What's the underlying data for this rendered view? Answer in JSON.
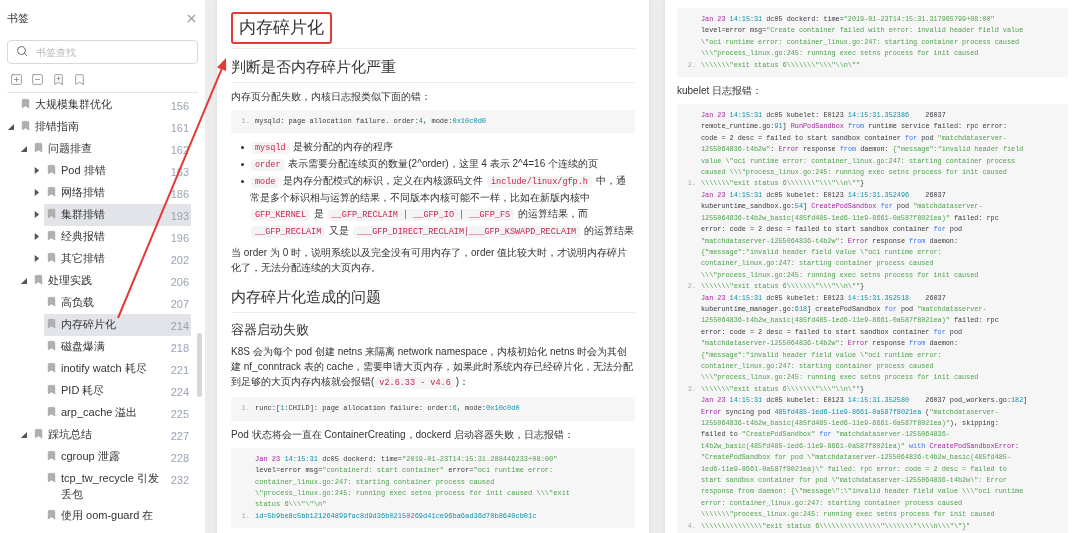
{
  "sidebar": {
    "title": "书签",
    "search": {
      "placeholder": "书签查找"
    },
    "tree": [
      {
        "label": "大规模集群优化",
        "page": "156",
        "selected": false
      },
      {
        "label": "排错指南",
        "page": "161",
        "selected": false,
        "expanded": true,
        "children": [
          {
            "label": "问题排查",
            "page": "162",
            "selected": false,
            "expanded": true,
            "children": [
              {
                "label": "Pod 排错",
                "page": "163",
                "selected": false,
                "expanded": false
              },
              {
                "label": "网络排错",
                "page": "186",
                "selected": false,
                "expanded": false
              },
              {
                "label": "集群排错",
                "page": "193",
                "selected": true,
                "expanded": false
              },
              {
                "label": "经典报错",
                "page": "196",
                "selected": false,
                "expanded": false
              },
              {
                "label": "其它排错",
                "page": "202",
                "selected": false,
                "expanded": false
              }
            ]
          },
          {
            "label": "处理实践",
            "page": "206",
            "selected": false,
            "expanded": true,
            "children": [
              {
                "label": "高负载",
                "page": "207",
                "selected": false
              },
              {
                "label": "内存碎片化",
                "page": "214",
                "selected": true
              },
              {
                "label": "磁盘爆满",
                "page": "218",
                "selected": false
              },
              {
                "label": "inotify watch 耗尽",
                "page": "221",
                "selected": false
              },
              {
                "label": "PID 耗尽",
                "page": "224",
                "selected": false
              },
              {
                "label": "arp_cache 溢出",
                "page": "225",
                "selected": false
              }
            ]
          },
          {
            "label": "踩坑总结",
            "page": "227",
            "selected": false,
            "expanded": true,
            "children": [
              {
                "label": "cgroup 泄露",
                "page": "228",
                "selected": false
              },
              {
                "label": "tcp_tw_recycle 引发丢包",
                "page": "232",
                "selected": false
              },
              {
                "label": "使用 oom-guard 在",
                "selected": false
              }
            ]
          }
        ]
      }
    ]
  },
  "left_page": {
    "title": "内存碎片化",
    "blocks": [
      {
        "kind": "h2",
        "text": "判断是否内存碎片化严重"
      },
      {
        "kind": "para",
        "segments": [
          {
            "kind": "text",
            "text": "内存页分配失败，内核日志报类似下面的错："
          }
        ]
      },
      {
        "kind": "code",
        "lines": [
          {
            "number": "1.",
            "segments": [
              {
                "kind": "plain",
                "text": "mysqld: page allocation failure. order:"
              },
              {
                "kind": "num",
                "text": "4"
              },
              {
                "kind": "plain",
                "text": ", mode:"
              },
              {
                "kind": "num",
                "text": "0x10c0d0"
              }
            ]
          }
        ]
      },
      {
        "kind": "bullets",
        "items": [
          {
            "segments": [
              {
                "kind": "code",
                "text": "mysqld"
              },
              {
                "kind": "text",
                "text": " 是被分配的内存的程序"
              }
            ]
          },
          {
            "segments": [
              {
                "kind": "code",
                "text": "order"
              },
              {
                "kind": "text",
                "text": " 表示需要分配连续页的数量(2^order)，这里 4 表示 2^4=16 个连续的页"
              }
            ]
          },
          {
            "segments": [
              {
                "kind": "code",
                "text": "mode"
              },
              {
                "kind": "text",
                "text": " 是内存分配模式的标识，定义在内核源码文件 "
              },
              {
                "kind": "code",
                "text": "include/linux/gfp.h"
              },
              {
                "kind": "text",
                "text": " 中，通常是多个标识相与运算的结果，不同版本内核可能不一样，比如在新版内核中 "
              },
              {
                "kind": "code",
                "text": "GFP_KERNEL"
              },
              {
                "kind": "text",
                "text": " 是 "
              },
              {
                "kind": "code",
                "text": "__GFP_RECLAIM | __GFP_IO | __GFP_FS"
              },
              {
                "kind": "text",
                "text": " 的运算结果，而 "
              },
              {
                "kind": "code",
                "text": "__GFP_RECLAIM"
              },
              {
                "kind": "text",
                "text": " 又是 "
              },
              {
                "kind": "code",
                "text": "___GFP_DIRECT_RECLAIM|___GFP_KSWAPD_RECLAIM"
              },
              {
                "kind": "text",
                "text": " 的运算结果"
              }
            ]
          }
        ]
      },
      {
        "kind": "para",
        "segments": [
          {
            "kind": "text",
            "text": "当 order 为 0 时，说明系统以及完全没有可用内存了，order 值比较大时，才说明内存碎片化了，无法分配连续的大页内存。"
          }
        ]
      },
      {
        "kind": "h2",
        "text": "内存碎片化造成的问题"
      },
      {
        "kind": "h3",
        "text": "容器启动失败"
      },
      {
        "kind": "para",
        "segments": [
          {
            "kind": "text",
            "text": "K8S 会为每个 pod 创建 netns 来隔离 network namespace，内核初始化 netns 时会为其创建 nf_conntrack 表的 cache，需要申请大页内存，如果此时系统内存已经碎片化，无法分配到足够的大页内存内核就会报错("
          },
          {
            "kind": "code",
            "text": "v2.6.33 - v4.6"
          },
          {
            "kind": "text",
            "text": ")："
          }
        ]
      },
      {
        "kind": "code",
        "lines": [
          {
            "number": "1.",
            "segments": [
              {
                "kind": "plain",
                "text": "runc:["
              },
              {
                "kind": "num",
                "text": "1"
              },
              {
                "kind": "plain",
                "text": ":CHILD]: page allocation failure: order:"
              },
              {
                "kind": "num",
                "text": "6"
              },
              {
                "kind": "plain",
                "text": ", mode:"
              },
              {
                "kind": "num",
                "text": "0x10c0d0"
              }
            ]
          }
        ]
      },
      {
        "kind": "para",
        "segments": [
          {
            "kind": "text",
            "text": "Pod 状态将会一直在 ContainerCreating，dockerd 启动容器失败，日志报错："
          }
        ]
      },
      {
        "kind": "code",
        "lines": [
          {
            "segments": [
              {
                "kind": "kw",
                "text": "Jan 23 "
              },
              {
                "kind": "num",
                "text": "14:15:31"
              },
              {
                "kind": "plain",
                "text": " dc05 dockerd: time="
              },
              {
                "kind": "str",
                "text": "\"2019-01-23T14:15:31.288446233+08:00\""
              }
            ]
          },
          {
            "segments": [
              {
                "kind": "plain",
                "text": "level=error msg="
              },
              {
                "kind": "str",
                "text": "\"containerd: start container\""
              },
              {
                "kind": "plain",
                "text": " error="
              },
              {
                "kind": "str",
                "text": "\"oci runtime error:"
              }
            ]
          },
          {
            "segments": [
              {
                "kind": "str",
                "text": "container_linux.go:247: starting container process caused"
              }
            ]
          },
          {
            "segments": [
              {
                "kind": "str",
                "text": "\\\"process_linux.go:245: running exec setns process for init caused \\\\\\\"exit"
              }
            ]
          },
          {
            "segments": [
              {
                "kind": "str",
                "text": "status 6\\\\\\\"\\\"\\n\""
              }
            ]
          },
          {
            "number": "1.",
            "segments": [
              {
                "kind": "num",
                "text": "id=5b9be8c5bb121264899fac8d9d36b02150269d41ce96ba6ad36d70b8640cb01c"
              }
            ]
          }
        ]
      }
    ]
  },
  "right_page": {
    "blocks": [
      {
        "kind": "code",
        "lines": [
          {
            "segments": [
              {
                "kind": "kw",
                "text": "Jan 23 "
              },
              {
                "kind": "num",
                "text": "14:15:31"
              },
              {
                "kind": "plain",
                "text": " dc05 dockerd: time="
              },
              {
                "kind": "str",
                "text": "\"2019-01-23T14:15:31.317965799+08:00\""
              }
            ]
          },
          {
            "segments": [
              {
                "kind": "plain",
                "text": "level=error msg="
              },
              {
                "kind": "str",
                "text": "\"Create container failed with error: invalid header field value"
              }
            ]
          },
          {
            "segments": [
              {
                "kind": "str",
                "text": "\\\"oci runtime error: container_linux.go:247: starting container process caused"
              }
            ]
          },
          {
            "segments": [
              {
                "kind": "str",
                "text": "\\\\\\\"process_linux.go:245: running exec setns process for init caused"
              }
            ]
          },
          {
            "number": "2.",
            "segments": [
              {
                "kind": "str",
                "text": "\\\\\\\\\\\\\\\"exit status 6\\\\\\\\\\\\\\\"\\\\\\\"\\\\n\\\"\""
              }
            ]
          }
        ]
      },
      {
        "kind": "para",
        "segments": [
          {
            "kind": "text",
            "text": "kubelet 日志报错："
          }
        ]
      },
      {
        "kind": "code",
        "lines": [
          {
            "segments": [
              {
                "kind": "kw",
                "text": "Jan 23 "
              },
              {
                "kind": "num",
                "text": "14:15:31"
              },
              {
                "kind": "plain",
                "text": " dc05 kubelet: E0123 "
              },
              {
                "kind": "num",
                "text": "14:15:31.352386"
              },
              {
                "kind": "plain",
                "text": "    26037"
              }
            ]
          },
          {
            "segments": [
              {
                "kind": "plain",
                "text": "remote_runtime.go:"
              },
              {
                "kind": "num",
                "text": "91"
              },
              {
                "kind": "plain",
                "text": "] "
              },
              {
                "kind": "kw",
                "text": "RunPodSandbox"
              },
              {
                "kind": "key",
                "text": " from"
              },
              {
                "kind": "plain",
                "text": " runtime service failed: rpc error:"
              }
            ]
          },
          {
            "segments": [
              {
                "kind": "plain",
                "text": "code = 2 desc = failed to start sandbox container "
              },
              {
                "kind": "key",
                "text": "for"
              },
              {
                "kind": "plain",
                "text": " pod "
              },
              {
                "kind": "str",
                "text": "\"matchdataserver-"
              }
            ]
          },
          {
            "segments": [
              {
                "kind": "str",
                "text": "1255064836-t4b2w\""
              },
              {
                "kind": "plain",
                "text": ": "
              },
              {
                "kind": "kw",
                "text": "Error"
              },
              {
                "kind": "plain",
                "text": " response "
              },
              {
                "kind": "key",
                "text": "from"
              },
              {
                "kind": "plain",
                "text": " daemon: "
              },
              {
                "kind": "str",
                "text": "{\"message\":\"invalid header field"
              }
            ]
          },
          {
            "segments": [
              {
                "kind": "str",
                "text": "value \\\"oci runtime error: container_linux.go:247: starting container process"
              }
            ]
          },
          {
            "segments": [
              {
                "kind": "str",
                "text": "caused \\\\\\\"process_linux.go:245: running exec setns process for init caused"
              }
            ]
          },
          {
            "number": "1.",
            "segments": [
              {
                "kind": "str",
                "text": "\\\\\\\\\\\\\\\"exit status 6\\\\\\\\\\\\\\\"\\\\\\\"\\\\n\\\"\""
              },
              {
                "kind": "plain",
                "text": "}"
              }
            ]
          },
          {
            "segments": [
              {
                "kind": "kw",
                "text": "Jan 23 "
              },
              {
                "kind": "num",
                "text": "14:15:31"
              },
              {
                "kind": "plain",
                "text": " dc05 kubelet: E0123 "
              },
              {
                "kind": "num",
                "text": "14:15:31.352496"
              },
              {
                "kind": "plain",
                "text": "    26037"
              }
            ]
          },
          {
            "segments": [
              {
                "kind": "plain",
                "text": "kuberuntime_sandbox.go:"
              },
              {
                "kind": "num",
                "text": "54"
              },
              {
                "kind": "plain",
                "text": "] "
              },
              {
                "kind": "kw",
                "text": "CreatePodSandbox"
              },
              {
                "kind": "key",
                "text": " for"
              },
              {
                "kind": "plain",
                "text": " pod "
              },
              {
                "kind": "str",
                "text": "\"matchdataserver-"
              }
            ]
          },
          {
            "segments": [
              {
                "kind": "str",
                "text": "1255064836-t4b2w_basic(485fd485-1ed6-11e9-8661-0a587f8021ea)\""
              },
              {
                "kind": "plain",
                "text": " failed: rpc"
              }
            ]
          },
          {
            "segments": [
              {
                "kind": "plain",
                "text": "error: code = 2 desc = failed to start sandbox container "
              },
              {
                "kind": "key",
                "text": "for"
              },
              {
                "kind": "plain",
                "text": " pod"
              }
            ]
          },
          {
            "segments": [
              {
                "kind": "str",
                "text": "\"matchdataserver-1255064836-t4b2w\""
              },
              {
                "kind": "plain",
                "text": ": "
              },
              {
                "kind": "kw",
                "text": "Error"
              },
              {
                "kind": "plain",
                "text": " response "
              },
              {
                "kind": "key",
                "text": "from"
              },
              {
                "kind": "plain",
                "text": " daemon:"
              }
            ]
          },
          {
            "segments": [
              {
                "kind": "str",
                "text": "{\"message\":\"invalid header field value \\\"oci runtime error:"
              }
            ]
          },
          {
            "segments": [
              {
                "kind": "str",
                "text": "container_linux.go:247: starting container process caused"
              }
            ]
          },
          {
            "segments": [
              {
                "kind": "str",
                "text": "\\\\\\\"process_linux.go:245: running exec setns process for init caused"
              }
            ]
          },
          {
            "number": "2.",
            "segments": [
              {
                "kind": "str",
                "text": "\\\\\\\\\\\\\\\"exit status 6\\\\\\\\\\\\\\\"\\\\\\\"\\\\n\\\"\""
              },
              {
                "kind": "plain",
                "text": "}"
              }
            ]
          },
          {
            "segments": [
              {
                "kind": "kw",
                "text": "Jan 23 "
              },
              {
                "kind": "num",
                "text": "14:15:31"
              },
              {
                "kind": "plain",
                "text": " dc05 kubelet: E0123 "
              },
              {
                "kind": "num",
                "text": "14:15:31.352518"
              },
              {
                "kind": "plain",
                "text": "    26037"
              }
            ]
          },
          {
            "segments": [
              {
                "kind": "plain",
                "text": "kuberuntime_manager.go:"
              },
              {
                "kind": "num",
                "text": "618"
              },
              {
                "kind": "plain",
                "text": "] createPodSandbox "
              },
              {
                "kind": "key",
                "text": "for"
              },
              {
                "kind": "plain",
                "text": " pod "
              },
              {
                "kind": "str",
                "text": "\"matchdataserver-"
              }
            ]
          },
          {
            "segments": [
              {
                "kind": "str",
                "text": "1255064836-t4b2w_basic(485fd485-1ed6-11e9-8661-0a587f8021ea)\""
              },
              {
                "kind": "plain",
                "text": " failed: rpc"
              }
            ]
          },
          {
            "segments": [
              {
                "kind": "plain",
                "text": "error: code = 2 desc = failed to start sandbox container "
              },
              {
                "kind": "key",
                "text": "for"
              },
              {
                "kind": "plain",
                "text": " pod"
              }
            ]
          },
          {
            "segments": [
              {
                "kind": "str",
                "text": "\"matchdataserver-1255064836-t4b2w\""
              },
              {
                "kind": "plain",
                "text": ": "
              },
              {
                "kind": "kw",
                "text": "Error"
              },
              {
                "kind": "plain",
                "text": " response "
              },
              {
                "kind": "key",
                "text": "from"
              },
              {
                "kind": "plain",
                "text": " daemon:"
              }
            ]
          },
          {
            "segments": [
              {
                "kind": "str",
                "text": "{\"message\":\"invalid header field value \\\"oci runtime error:"
              }
            ]
          },
          {
            "segments": [
              {
                "kind": "str",
                "text": "container_linux.go:247: starting container process caused"
              }
            ]
          },
          {
            "segments": [
              {
                "kind": "str",
                "text": "\\\\\\\"process_linux.go:245: running exec setns process for init caused"
              }
            ]
          },
          {
            "number": "3.",
            "segments": [
              {
                "kind": "str",
                "text": "\\\\\\\\\\\\\\\"exit status 6\\\\\\\\\\\\\\\"\\\\\\\"\\\\n\\\"\""
              },
              {
                "kind": "plain",
                "text": "}"
              }
            ]
          },
          {
            "segments": [
              {
                "kind": "kw",
                "text": "Jan 23 "
              },
              {
                "kind": "num",
                "text": "14:15:31"
              },
              {
                "kind": "plain",
                "text": " dc05 kubelet: E0123 "
              },
              {
                "kind": "num",
                "text": "14:15:31.352580"
              },
              {
                "kind": "plain",
                "text": "    26037 pod_workers.go:"
              },
              {
                "kind": "num",
                "text": "182"
              },
              {
                "kind": "plain",
                "text": "]"
              }
            ]
          },
          {
            "segments": [
              {
                "kind": "kw",
                "text": "Error"
              },
              {
                "kind": "plain",
                "text": " syncing pod "
              },
              {
                "kind": "num",
                "text": "485fd485-1ed6-11e9-8661-0a587f8021ea"
              },
              {
                "kind": "plain",
                "text": " ("
              },
              {
                "kind": "str",
                "text": "\"matchdataserver-"
              }
            ]
          },
          {
            "segments": [
              {
                "kind": "str",
                "text": "1255064836-t4b2w_basic(485fd485-1ed6-11e9-8661-0a587f8021ea)\""
              },
              {
                "kind": "plain",
                "text": "), skipping:"
              }
            ]
          },
          {
            "segments": [
              {
                "kind": "plain",
                "text": "failed to "
              },
              {
                "kind": "str",
                "text": "\"CreatePodSandbox\""
              },
              {
                "kind": "key",
                "text": " for "
              },
              {
                "kind": "str",
                "text": "\"matchdataserver-1255064836-"
              }
            ]
          },
          {
            "segments": [
              {
                "kind": "str",
                "text": "t4b2w_basic(485fd485-1ed6-11e9-8661-0a587f8021ea)\""
              },
              {
                "kind": "key",
                "text": " with "
              },
              {
                "kind": "kw",
                "text": "CreatePodSandboxError"
              },
              {
                "kind": "plain",
                "text": ":"
              }
            ]
          },
          {
            "segments": [
              {
                "kind": "str",
                "text": "\"CreatePodSandbox for pod \\\"matchdataserver-1255064836-t4b2w_basic(485fd485-"
              }
            ]
          },
          {
            "segments": [
              {
                "kind": "str",
                "text": "1ed6-11e9-8661-0a587f8021ea)\\\" failed: rpc error: code = 2 desc = failed to"
              }
            ]
          },
          {
            "segments": [
              {
                "kind": "str",
                "text": "start sandbox container for pod \\\"matchdataserver-1255064836-t4b2w\\\": Error"
              }
            ]
          },
          {
            "segments": [
              {
                "kind": "str",
                "text": "response from daemon: {\\\"message\\\":\\\"invalid header field value \\\\\\\"oci runtime"
              }
            ]
          },
          {
            "segments": [
              {
                "kind": "str",
                "text": "error: container_linux.go:247: starting container process caused"
              }
            ]
          },
          {
            "segments": [
              {
                "kind": "str",
                "text": "\\\\\\\\\\\\\\\"process_linux.go:245: running exec setns process for init caused"
              }
            ]
          },
          {
            "number": "4.",
            "segments": [
              {
                "kind": "str",
                "text": "\\\\\\\\\\\\\\\\\\\\\\\\\\\\\\\"exit status 6\\\\\\\\\\\\\\\\\\\\\\\\\\\\\\\"\\\\\\\\\\\\\\\"\\\\\\\\n\\\\\\\"\\\"}\""
              }
            ]
          }
        ]
      }
    ]
  }
}
